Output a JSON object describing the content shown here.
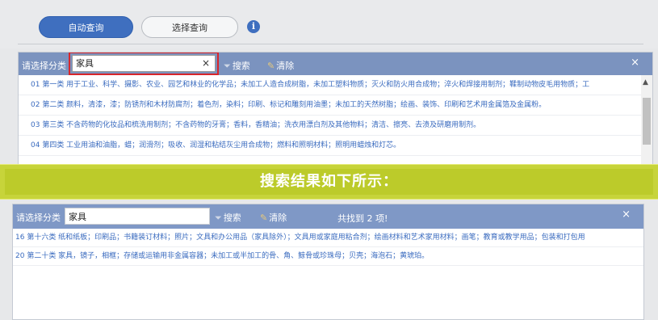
{
  "tabs": {
    "auto_query": "自动查询",
    "select_query": "选择查询",
    "info_icon": "i"
  },
  "panel1": {
    "label": "请选择分类",
    "search_value": "家具",
    "clear_x": "×",
    "filter_label": "搜索",
    "clear_label": "清除",
    "close": "×",
    "rows": [
      "01 第一类 用于工业、科学、摄影、农业、园艺和林业的化学品；未加工人造合成树脂，未加工塑料物质；灭火和防火用合成物；淬火和焊接用制剂；鞣制动物皮毛用物质；工",
      "02 第二类 颜料，清漆，漆；防锈剂和木材防腐剂；着色剂，染料；印刷、标记和雕刻用油墨；未加工的天然树脂；绘画、装饰、印刷和艺术用金属箔及金属粉。",
      "03 第三类 不含药物的化妆品和梳洗用制剂；不含药物的牙膏；香料，香精油；洗衣用漂白剂及其他物料；清洁、擦亮、去渍及研磨用制剂。",
      "04 第四类 工业用油和油脂，蜡；润滑剂；吸收、润湿和粘结灰尘用合成物；燃料和照明材料；照明用蜡烛和灯芯。"
    ]
  },
  "banner": {
    "text": "搜索结果如下所示："
  },
  "panel2": {
    "label": "请选择分类",
    "search_value": "家具",
    "filter_label": "搜索",
    "clear_label": "清除",
    "found_text": "共找到 2 项!",
    "close": "×",
    "rows": [
      "16 第十六类 纸和纸板；印刷品；书籍装订材料；照片；文具和办公用品（家具除外）；文具用或家庭用粘合剂；绘画材料和艺术家用材料；画笔；教育或教学用品；包装和打包用",
      "20 第二十类 家具，镜子，相框；存储或运输用非金属容器；未加工或半加工的骨、角、鲸骨或珍珠母；贝壳；海泡石；黄琥珀。"
    ]
  },
  "colors": {
    "accent": "#3f6fbf",
    "header": "#7b93bf",
    "banner": "#c7d43a",
    "highlight": "#d8262b"
  }
}
